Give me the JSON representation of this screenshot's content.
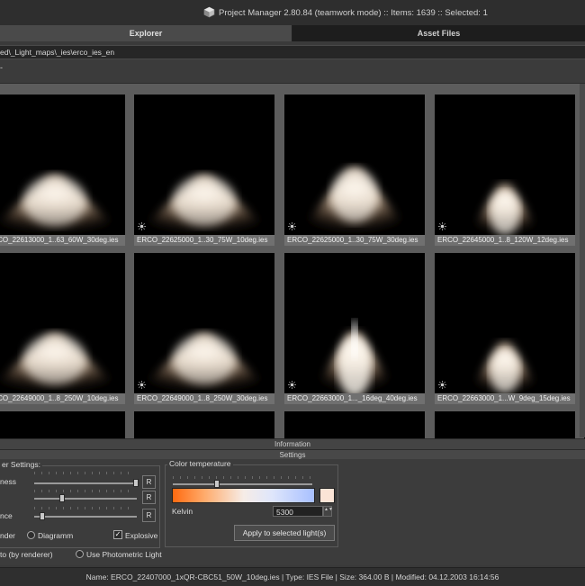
{
  "window": {
    "title": "Project Manager 2.80.84 (teamwork mode)  :: Items: 1639  :: Selected: 1"
  },
  "tabs": [
    {
      "label": "Explorer",
      "active": true
    },
    {
      "label": "Asset Files",
      "active": false
    }
  ],
  "path": "ed\\_Light_maps\\_ies\\erco_ies_en",
  "toolbar": {
    "dash": "-"
  },
  "thumbnails": [
    {
      "label": "ERCO_22613000_1..63_60W_30deg.ies",
      "shape": "wide"
    },
    {
      "label": "ERCO_22625000_1..30_75W_10deg.ies",
      "shape": "wide"
    },
    {
      "label": "ERCO_22625000_1..30_75W_30deg.ies",
      "shape": "medium"
    },
    {
      "label": "ERCO_22645000_1..8_120W_12deg.ies",
      "shape": "narrow"
    },
    {
      "label": "ERCO_22649000_1..8_250W_10deg.ies",
      "shape": "wide"
    },
    {
      "label": "ERCO_22649000_1..8_250W_30deg.ies",
      "shape": "wide"
    },
    {
      "label": "ERCO_22663000_1..._16deg_40deg.ies",
      "shape": "spike"
    },
    {
      "label": "ERCO_22663000_1...W_9deg_15deg.ies",
      "shape": "narrow"
    }
  ],
  "panels": {
    "information": "Information",
    "settings": "Settings"
  },
  "render_settings": {
    "title": "er Settings:",
    "rows": [
      {
        "label": "ness",
        "reset": "R"
      },
      {
        "label": "",
        "reset": "R"
      },
      {
        "label": "nce",
        "reset": "R"
      }
    ],
    "mode_render": "nder",
    "mode_diagram": "Diagramm",
    "explosive_label": "Explosive",
    "explosive_checked": true,
    "check_glyph": "✓",
    "source_renderer": "to (by renderer)",
    "source_photometric": "Use Photometric Light"
  },
  "color_temperature": {
    "title": "Color temperature",
    "kelvin_label": "Kelvin",
    "kelvin_value": "5300",
    "apply_label": "Apply to selected light(s)",
    "spin_glyph": "▲▼"
  },
  "status": {
    "text": "Name: ERCO_22407000_1xQR-CBC51_50W_10deg.ies | Type: IES File | Size: 364.00 B | Modified: 04.12.2003 16:14:56"
  }
}
